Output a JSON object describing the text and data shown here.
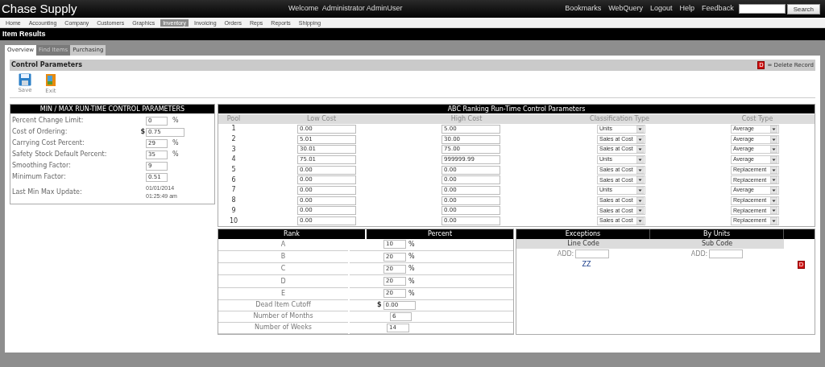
{
  "app": {
    "title": "Chase Supply",
    "welcome": "Welcome  Administrator AdminUser",
    "links": [
      "Bookmarks",
      "WebQuery",
      "Logout",
      "Help",
      "Feedback"
    ],
    "search_button": "Search"
  },
  "nav": [
    {
      "label": "Home",
      "selected": false
    },
    {
      "label": "Accounting",
      "selected": false
    },
    {
      "label": "Company",
      "selected": false
    },
    {
      "label": "Customers",
      "selected": false
    },
    {
      "label": "Graphics",
      "selected": false
    },
    {
      "label": "Inventory",
      "selected": true
    },
    {
      "label": "Invoicing",
      "selected": false
    },
    {
      "label": "Orders",
      "selected": false
    },
    {
      "label": "Reps",
      "selected": false
    },
    {
      "label": "Reports",
      "selected": false
    },
    {
      "label": "Shipping",
      "selected": false
    }
  ],
  "page_title": "Item Results",
  "tabs": [
    {
      "label": "Overview",
      "selected": true
    },
    {
      "label": "Find Items",
      "selected": false
    },
    {
      "label": "Purchasing",
      "selected": false
    }
  ],
  "panel": {
    "title": "Control Parameters",
    "legend_icon": "D",
    "legend": "= Delete Record"
  },
  "toolbar": [
    {
      "kind": "save",
      "label": "Save"
    },
    {
      "kind": "exit",
      "label": "Exit"
    }
  ],
  "minmax": {
    "title": "MIN / MAX RUN-TIME CONTROL PARAMETERS",
    "rows": [
      {
        "kind": "input",
        "label": "Percent Change Limit:",
        "value": "0",
        "suffix": "%"
      },
      {
        "kind": "input",
        "label": "Cost of Ordering:",
        "value": "0.75",
        "prefix": "$"
      },
      {
        "kind": "input",
        "label": "Carrying Cost Percent:",
        "value": "29",
        "suffix": "%"
      },
      {
        "kind": "input",
        "label": "Safety Stock Default Percent:",
        "value": "35",
        "suffix": "%"
      },
      {
        "kind": "input",
        "label": "Smoothing Factor:",
        "value": "9"
      },
      {
        "kind": "input",
        "label": "Minimum Factor:",
        "value": "0.51"
      },
      {
        "kind": "text",
        "label": "Last Min Max Update:",
        "lines": [
          "01/01/2014",
          "01:25:49 am"
        ]
      }
    ]
  },
  "abc": {
    "title": "ABC Ranking Run-Time Control Parameters",
    "columns": [
      "Pool",
      "Low Cost",
      "High Cost",
      "Classification Type",
      "Cost Type"
    ],
    "rows": [
      {
        "pool": "1",
        "low": "0.00",
        "high": "5.00",
        "classification": "Units",
        "cost_type": "Average"
      },
      {
        "pool": "2",
        "low": "5.01",
        "high": "30.00",
        "classification": "Sales at Cost",
        "cost_type": "Average"
      },
      {
        "pool": "3",
        "low": "30.01",
        "high": "75.00",
        "classification": "Sales at Cost",
        "cost_type": "Average"
      },
      {
        "pool": "4",
        "low": "75.01",
        "high": "999999.99",
        "classification": "Units",
        "cost_type": "Average"
      },
      {
        "pool": "5",
        "low": "0.00",
        "high": "0.00",
        "classification": "Sales at Cost",
        "cost_type": "Replacement"
      },
      {
        "pool": "6",
        "low": "0.00",
        "high": "0.00",
        "classification": "Sales at Cost",
        "cost_type": "Replacement"
      },
      {
        "pool": "7",
        "low": "0.00",
        "high": "0.00",
        "classification": "Units",
        "cost_type": "Average"
      },
      {
        "pool": "8",
        "low": "0.00",
        "high": "0.00",
        "classification": "Sales at Cost",
        "cost_type": "Replacement"
      },
      {
        "pool": "9",
        "low": "0.00",
        "high": "0.00",
        "classification": "Sales at Cost",
        "cost_type": "Replacement"
      },
      {
        "pool": "10",
        "low": "0.00",
        "high": "0.00",
        "classification": "Sales at Cost",
        "cost_type": "Replacement"
      }
    ]
  },
  "rank": {
    "columns": [
      "Rank",
      "Percent"
    ],
    "rows": [
      {
        "kind": "short",
        "label": "A",
        "value": "10",
        "suffix": "%"
      },
      {
        "kind": "short",
        "label": "B",
        "value": "20",
        "suffix": "%"
      },
      {
        "kind": "short",
        "label": "C",
        "value": "20",
        "suffix": "%"
      },
      {
        "kind": "short",
        "label": "D",
        "value": "20",
        "suffix": "%"
      },
      {
        "kind": "short",
        "label": "E",
        "value": "20",
        "suffix": "%"
      },
      {
        "kind": "wide",
        "label": "Dead Item Cutoff",
        "value": "0.00",
        "prefix": "$"
      },
      {
        "kind": "short",
        "label": "Number of Months",
        "value": "6"
      },
      {
        "kind": "short",
        "label": "Number of Weeks",
        "value": "14"
      }
    ]
  },
  "exceptions": {
    "columns": [
      "Exceptions",
      "By Units"
    ],
    "subcolumns": [
      "Line Code",
      "Sub Code"
    ],
    "add_fields": [
      {
        "label": "ADD:"
      },
      {
        "label": "ADD:"
      }
    ],
    "entries": [
      {
        "code": "ZZ",
        "delete_icon": "D"
      }
    ]
  }
}
